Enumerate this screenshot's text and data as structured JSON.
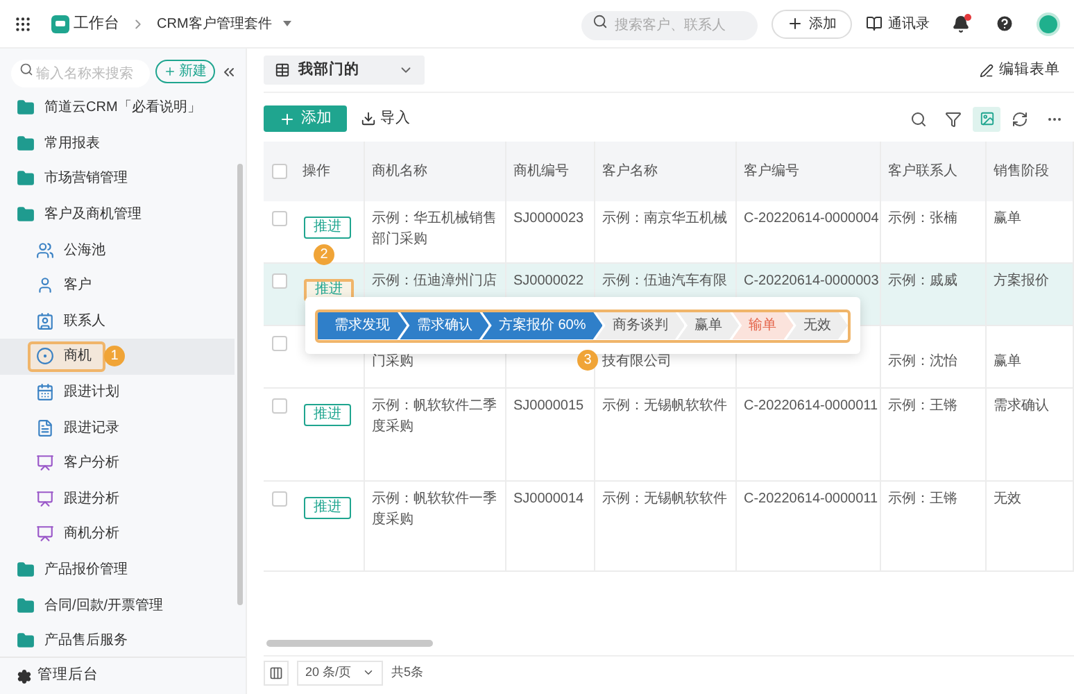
{
  "topbar": {
    "home": "工作台",
    "app": "CRM客户管理套件",
    "search": {
      "placeholder": "搜索客户、联系人"
    },
    "add_button": "添加",
    "contacts": "通讯录",
    "has_notification": true
  },
  "sidebar": {
    "search": {
      "placeholder": "输入名称来搜索"
    },
    "new_button": "新建",
    "items": [
      {
        "label": "简道云CRM「必看说明」",
        "kind": "folder",
        "selected": false
      },
      {
        "label": "常用报表",
        "kind": "folder",
        "selected": false
      },
      {
        "label": "市场营销管理",
        "kind": "folder",
        "selected": false
      },
      {
        "label": "客户及商机管理",
        "kind": "folder",
        "selected": false,
        "children": [
          {
            "label": "公海池",
            "kind": "pool",
            "selected": false
          },
          {
            "label": "客户",
            "kind": "person",
            "selected": false
          },
          {
            "label": "联系人",
            "kind": "card",
            "selected": false
          },
          {
            "label": "商机",
            "kind": "target",
            "selected": true,
            "annotation": "1"
          },
          {
            "label": "跟进计划",
            "kind": "plan",
            "selected": false
          },
          {
            "label": "跟进记录",
            "kind": "record",
            "selected": false
          },
          {
            "label": "客户分析",
            "kind": "analysis",
            "selected": false
          },
          {
            "label": "跟进分析",
            "kind": "analysis",
            "selected": false
          },
          {
            "label": "商机分析",
            "kind": "analysis",
            "selected": false
          }
        ]
      },
      {
        "label": "产品报价管理",
        "kind": "folder",
        "selected": false
      },
      {
        "label": "合同/回款/开票管理",
        "kind": "folder",
        "selected": false
      },
      {
        "label": "产品售后服务",
        "kind": "folder",
        "selected": false
      }
    ],
    "footer": "管理后台"
  },
  "view": {
    "label": "我部门的",
    "edit_form": "编辑表单"
  },
  "toolbar": {
    "add": "添加",
    "import": "导入"
  },
  "table": {
    "all_checked": false,
    "columns": [
      "操作",
      "商机名称",
      "商机编号",
      "客户名称",
      "客户编号",
      "客户联系人",
      "销售阶段"
    ],
    "rows": [
      {
        "checked": false,
        "highlighted": false,
        "action": "推进",
        "name": "示例：华五机械销售部门采购",
        "code": "SJ0000023",
        "customer": "示例：南京华五机械",
        "customer_no": "C-20220614-0000004",
        "contact": "示例：张楠",
        "stage": "赢单"
      },
      {
        "checked": false,
        "highlighted": true,
        "annotation": "2",
        "action": "推进",
        "name": "示例：伍迪漳州门店",
        "code": "SJ0000022",
        "customer": "示例：伍迪汽车有限",
        "customer_no": "C-20220614-0000003",
        "contact": "示例：戚威",
        "stage": "方案报价"
      },
      {
        "checked": false,
        "highlighted": false,
        "name": "门采购",
        "customer": "技有限公司",
        "contact": "示例：沈怡",
        "stage": "赢单"
      },
      {
        "checked": false,
        "highlighted": false,
        "action": "推进",
        "name": "示例：帆软软件二季度采购",
        "code": "SJ0000015",
        "customer": "示例：无锡帆软软件",
        "customer_no": "C-20220614-0000011",
        "contact": "示例：王锵",
        "stage": "需求确认"
      },
      {
        "checked": false,
        "highlighted": false,
        "action": "推进",
        "name": "示例：帆软软件一季度采购",
        "code": "SJ0000014",
        "customer": "示例：无锡帆软软件",
        "customer_no": "C-20220614-0000011",
        "contact": "示例：王锵",
        "stage": "无效"
      }
    ]
  },
  "stage_popover": {
    "annotation": "3",
    "stages": [
      {
        "label": "需求发现",
        "kind": "done"
      },
      {
        "label": "需求确认",
        "kind": "done"
      },
      {
        "label": "方案报价 60%",
        "kind": "done"
      },
      {
        "label": "商务谈判",
        "kind": "pending"
      },
      {
        "label": "赢单",
        "kind": "pending"
      },
      {
        "label": "输单",
        "kind": "lost"
      },
      {
        "label": "无效",
        "kind": "pending"
      }
    ]
  },
  "pagination": {
    "page_size": "20 条/页",
    "total": "共5条"
  }
}
